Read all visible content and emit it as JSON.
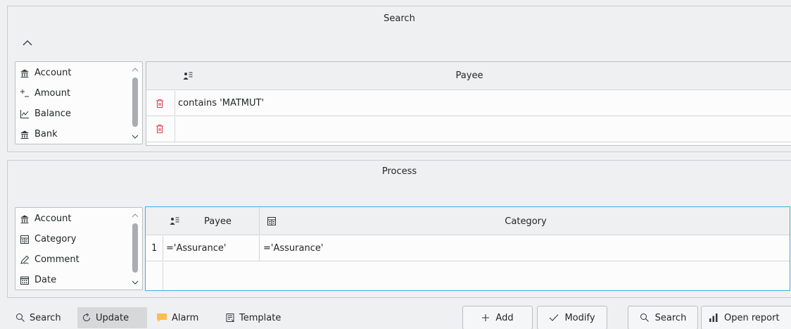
{
  "search": {
    "title": "Search",
    "fields": [
      {
        "label": "Account",
        "icon": "bank-icon"
      },
      {
        "label": "Amount",
        "icon": "plus-minus-icon"
      },
      {
        "label": "Balance",
        "icon": "chart-line-icon"
      },
      {
        "label": "Bank",
        "icon": "bank-icon"
      }
    ],
    "table": {
      "header_label": "Payee",
      "rows": [
        {
          "value": "contains 'MATMUT'"
        },
        {
          "value": ""
        }
      ]
    }
  },
  "process": {
    "title": "Process",
    "fields": [
      {
        "label": "Account",
        "icon": "bank-icon"
      },
      {
        "label": "Category",
        "icon": "category-icon"
      },
      {
        "label": "Comment",
        "icon": "pen-icon"
      },
      {
        "label": "Date",
        "icon": "calendar-icon"
      }
    ],
    "table": {
      "columns": [
        {
          "label": "Payee",
          "icon": "payee-icon"
        },
        {
          "label": "Category",
          "icon": "category-icon"
        }
      ],
      "rows": [
        {
          "num": "1",
          "payee": "='Assurance'",
          "category": "='Assurance'"
        }
      ]
    }
  },
  "toolbar": {
    "search": "Search",
    "update": "Update",
    "alarm": "Alarm",
    "template": "Template"
  },
  "actions": {
    "add": "Add",
    "modify": "Modify",
    "search": "Search",
    "open_report": "Open report"
  },
  "colors": {
    "accent": "#3daee9",
    "delete": "#da4453",
    "alarm": "#fdbc4b"
  }
}
